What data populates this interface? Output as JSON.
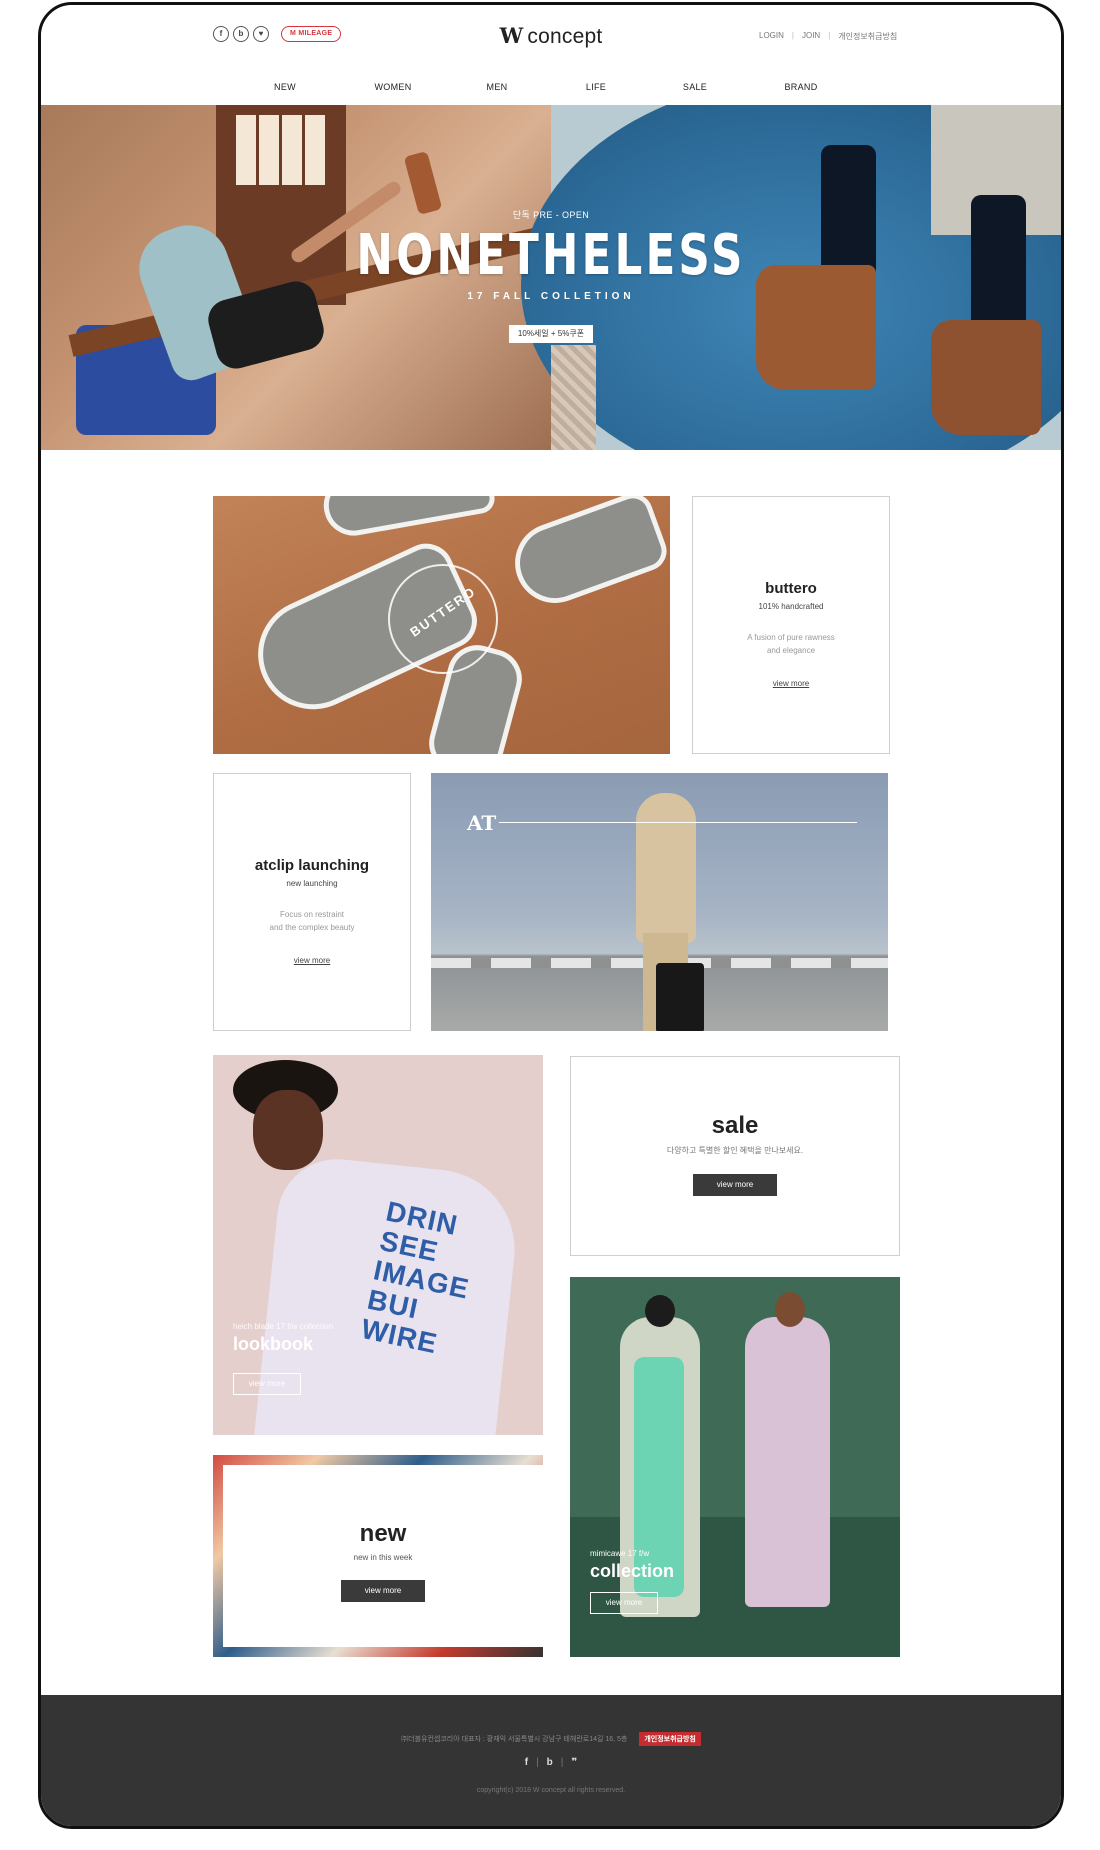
{
  "header": {
    "sns": [
      "f",
      "b",
      "♥"
    ],
    "mileage_label": "M MILEAGE",
    "logo_mark": "W",
    "logo_text": "concept",
    "util": {
      "login": "LOGIN",
      "join": "JOIN",
      "privacy": "개인정보취급방침"
    },
    "nav": [
      "NEW",
      "WOMEN",
      "MEN",
      "LIFE",
      "SALE",
      "BRAND"
    ]
  },
  "hero": {
    "pre": "단독 PRE - OPEN",
    "title": "NONETHELESS",
    "sub": "17 FALL COLLETION",
    "button": "10%세일 + 5%쿠폰"
  },
  "buttero": {
    "stamp": "BUTTERO",
    "title": "buttero",
    "sub": "101% handcrafted",
    "desc": "A fusion of pure rawness\nand elegance",
    "link": "view more"
  },
  "atclip": {
    "title": "atclip launching",
    "sub": "new launching",
    "desc": "Focus on restraint\nand the complex beauty",
    "link": "view more",
    "image_text": "AT"
  },
  "lookbook": {
    "print": "DRIN\nSEE\nIMAGE\nBUI\nWIRE",
    "small": "heich blade 17 f/w collection",
    "big": "lookbook",
    "button": "view more"
  },
  "sale": {
    "title": "sale",
    "sub": "다양하고 특별한 할인 혜택을 만나보세요.",
    "button": "view more"
  },
  "new": {
    "title": "new",
    "sub": "new in this week",
    "button": "view more"
  },
  "collection": {
    "small": "mimicawe 17 f/w",
    "big": "collection",
    "button": "view more"
  },
  "footer": {
    "info": "㈜더블유컨셉코리아 대표자 : 황재익 서울특별시 강남구 테헤란로14길 16, 5층",
    "privacy": "개인정보취급방침",
    "social": [
      "f",
      "b",
      "❞"
    ],
    "copyright": "copyright(c) 2018 W concept all rights reserved."
  }
}
